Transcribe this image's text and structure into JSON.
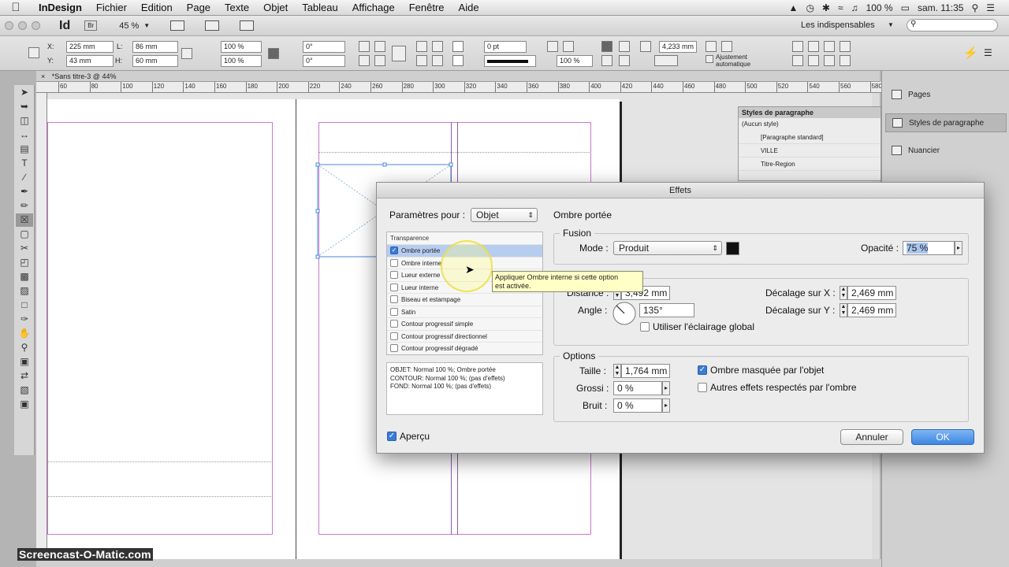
{
  "menubar": {
    "app_name": "InDesign",
    "items": [
      "Fichier",
      "Edition",
      "Page",
      "Texte",
      "Objet",
      "Tableau",
      "Affichage",
      "Fenêtre",
      "Aide"
    ],
    "battery": "100 %",
    "clock": "sam. 11:35"
  },
  "appbar": {
    "logo": "Id",
    "bridge_badge": "Br",
    "zoom": "45 %",
    "workspace": "Les indispensables",
    "search_placeholder": ""
  },
  "control": {
    "x": "225 mm",
    "y": "43 mm",
    "w": "86 mm",
    "h": "60 mm",
    "scale_x": "100 %",
    "scale_y": "100 %",
    "rotate": "0°",
    "shear": "0°",
    "stroke": "0 pt",
    "opacity": "100 %",
    "col_width": "4,233 mm",
    "autofit_label": "Ajustement automatique"
  },
  "document": {
    "tab_title": "*Sans titre-3 @ 44%",
    "ruler_ticks": [
      "60",
      "80",
      "100",
      "120",
      "140",
      "160",
      "180",
      "200",
      "220",
      "240",
      "260",
      "280",
      "300",
      "320",
      "340",
      "360",
      "380",
      "400",
      "420",
      "440",
      "460",
      "480",
      "500",
      "520",
      "540",
      "560",
      "580"
    ]
  },
  "dock": {
    "items": [
      {
        "label": "Pages"
      },
      {
        "label": "Styles de paragraphe"
      },
      {
        "label": "Nuancier"
      }
    ]
  },
  "para_styles": {
    "title": "Styles de paragraphe",
    "current": "(Aucun style)",
    "rows": [
      "[Paragraphe standard]",
      "VILLE",
      "Titre-Region"
    ]
  },
  "dialog": {
    "title": "Effets",
    "params_label": "Paramètres pour :",
    "params_value": "Objet",
    "section_title": "Ombre portée",
    "effects_header": "Transparence",
    "effects": [
      {
        "label": "Ombre portée",
        "checked": true
      },
      {
        "label": "Ombre interne",
        "checked": false
      },
      {
        "label": "Lueur externe",
        "checked": false
      },
      {
        "label": "Lueur interne",
        "checked": false
      },
      {
        "label": "Biseau et estampage",
        "checked": false
      },
      {
        "label": "Satin",
        "checked": false
      },
      {
        "label": "Contour progressif simple",
        "checked": false
      },
      {
        "label": "Contour progressif directionnel",
        "checked": false
      },
      {
        "label": "Contour progressif dégradé",
        "checked": false
      }
    ],
    "summary": [
      "OBJET: Normal 100 %; Ombre portée",
      "CONTOUR: Normal 100 %; (pas d'effets)",
      "FOND: Normal 100 %; (pas d'effets)"
    ],
    "fusion_title": "Fusion",
    "mode_label": "Mode :",
    "mode_value": "Produit",
    "opacity_label": "Opacité :",
    "opacity_value": "75 %",
    "distance_label": "Distance :",
    "distance_value": "3,492 mm",
    "angle_label": "Angle :",
    "angle_value": "135°",
    "global_light_label": "Utiliser l'éclairage global",
    "offset_x_label": "Décalage sur X :",
    "offset_x_value": "2,469 mm",
    "offset_y_label": "Décalage sur Y :",
    "offset_y_value": "2,469 mm",
    "options_title": "Options",
    "size_label": "Taille :",
    "size_value": "1,764 mm",
    "spread_label": "Grossi :",
    "spread_value": "0 %",
    "noise_label": "Bruit :",
    "noise_value": "0 %",
    "knockout_label": "Ombre masquée par l'objet",
    "honor_label": "Autres effets respectés par l'ombre",
    "preview_label": "Aperçu",
    "cancel_label": "Annuler",
    "ok_label": "OK"
  },
  "tooltip": {
    "line1": "Appliquer Ombre interne si cette option",
    "line2": "est activée."
  },
  "watermark": "Screencast-O-Matic.com",
  "colors": {
    "accent": "#3a7bd5",
    "guide_margin": "#c87ac8",
    "guide_column": "#8a5ab0",
    "tooltip_bg": "#ffffc6"
  }
}
